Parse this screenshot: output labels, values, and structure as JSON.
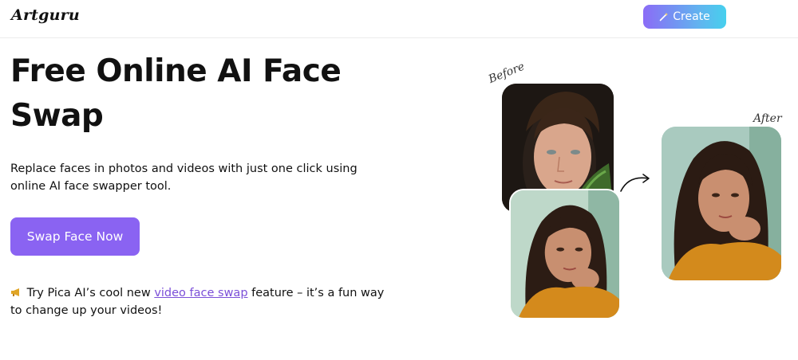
{
  "header": {
    "logo": "Artguru",
    "create_label": "Create",
    "create_icon": "magic-wand-icon"
  },
  "hero": {
    "title": "Free Online AI Face Swap",
    "subtitle": "Replace faces in photos and videos with just one click using online AI face swapper tool.",
    "cta_label": "Swap Face Now"
  },
  "promo": {
    "icon": "megaphone-icon",
    "prefix": "Try Pica AI’s cool new",
    "link_text": "video face swap",
    "suffix": "feature – it’s a fun way to change up your videos!"
  },
  "illustration": {
    "before_label": "Before",
    "after_label": "After",
    "arrow_icon": "curved-arrow-icon"
  },
  "colors": {
    "accent": "#8a63f2",
    "link": "#7b4fd8",
    "create_gradient_start": "#8b6cf6",
    "create_gradient_end": "#46d0ee"
  }
}
